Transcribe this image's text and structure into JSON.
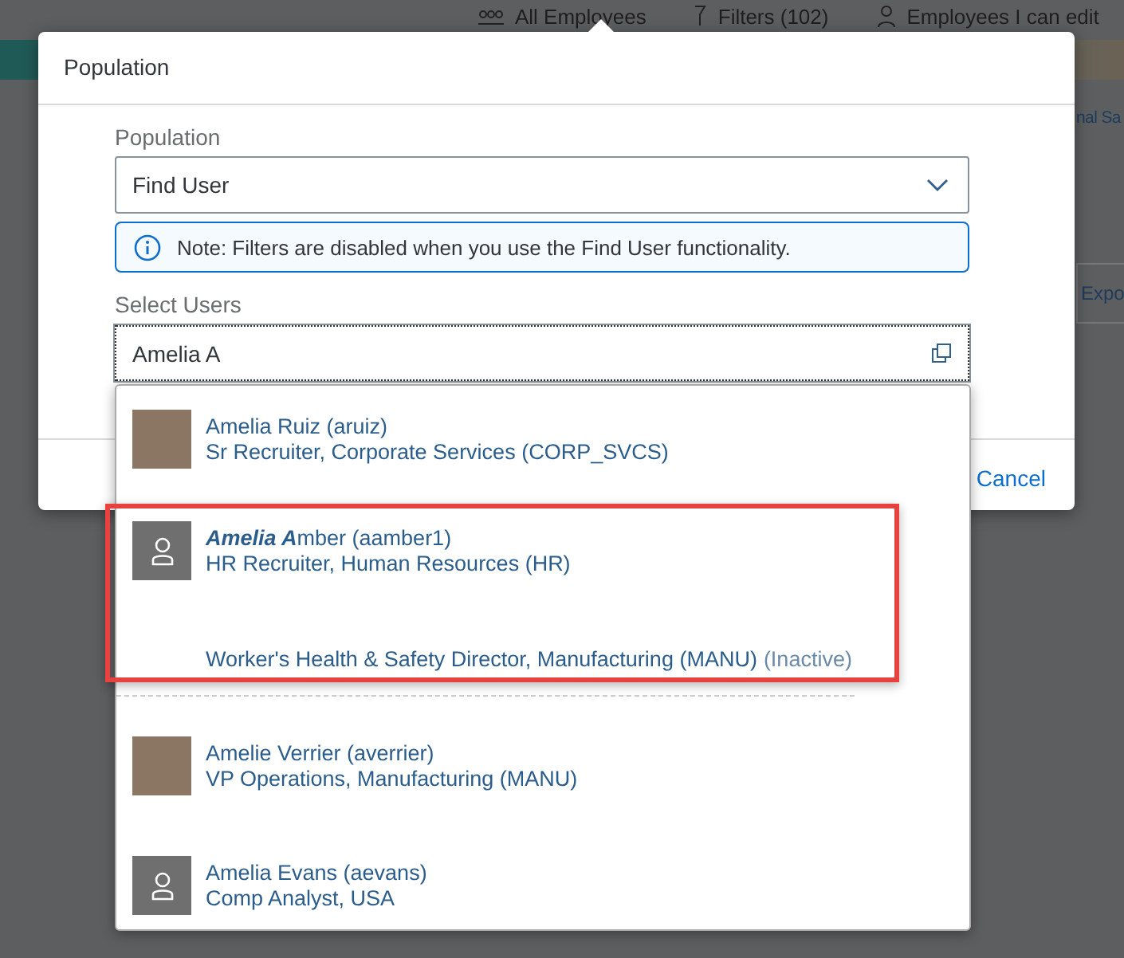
{
  "background": {
    "toolbar": [
      "All Employees",
      "Filters (102)",
      "Employees I can edit"
    ],
    "side_texts": [
      "nal Sa",
      "Expo"
    ]
  },
  "dialog": {
    "title": "Population",
    "population_label": "Population",
    "population_value": "Find User",
    "note": "Note: Filters are disabled when you use the Find User functionality.",
    "select_label": "Select Users",
    "select_value": "Amelia A",
    "cancel": "Cancel"
  },
  "suggestions": [
    {
      "kind": "photo",
      "name": "Amelia Ruiz (aruiz)",
      "lines": [
        "Sr Recruiter, Corporate Services (CORP_SVCS)"
      ],
      "highlighted": false
    },
    {
      "kind": "placeholder",
      "name": "**Amelia A**mber (aamber1)",
      "lines": [
        "HR Recruiter, Human Resources (HR)"
      ],
      "extra": {
        "text": "Worker's Health & Safety Director, Manufacturing (MANU)",
        "status": "(Inactive)"
      },
      "highlighted": true
    },
    {
      "kind": "photo",
      "name": "Amelie Verrier (averrier)",
      "lines": [
        "VP Operations, Manufacturing (MANU)"
      ],
      "highlighted": false
    },
    {
      "kind": "placeholder",
      "name": "Amelia Evans (aevans)",
      "lines": [
        "Comp Analyst, USA"
      ],
      "highlighted": false
    }
  ]
}
